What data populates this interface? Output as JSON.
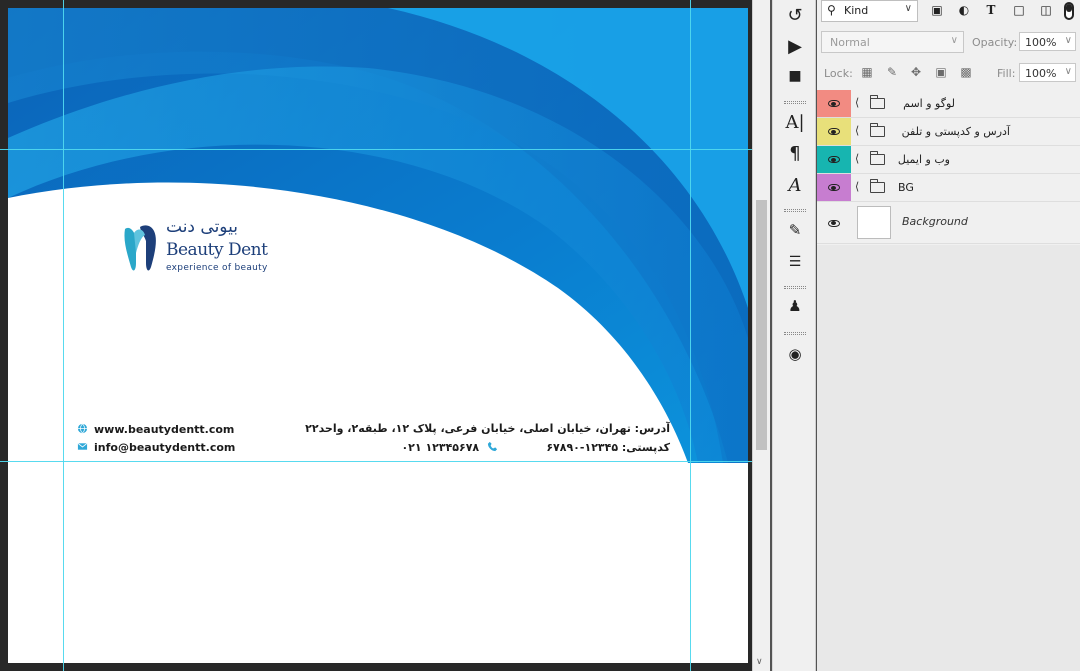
{
  "document": {
    "logo": {
      "persian_name": "بیوتی دنت",
      "english_name": "Beauty Dent",
      "tagline": "experience of beauty"
    },
    "contact": {
      "website": "www.beautydentt.com",
      "email": "info@beautydentt.com",
      "address": "آدرس: تهران، خیابان اصلی، خیابان فرعی، پلاک ۱۲، طبقه۲، واحد۲۲",
      "postal_code": "کدپستی: ۱۲۳۴۵-۶۷۸۹۰",
      "phone": "۰۲۱ ۱۲۳۴۵۶۷۸"
    },
    "colors": {
      "blue_dark": "#0a5cb0",
      "blue_mid": "#0d8ad6",
      "blue_light": "#24b2ee",
      "accent": "#2fb7e6"
    }
  },
  "tools": [
    {
      "icon": "history-brush-icon"
    },
    {
      "icon": "play-action-icon"
    },
    {
      "icon": "plugin-icon"
    },
    {
      "icon": "character-icon"
    },
    {
      "icon": "paragraph-icon"
    },
    {
      "icon": "glyphs-icon"
    },
    {
      "icon": "brush-presets-icon"
    },
    {
      "icon": "adjustments-icon"
    },
    {
      "icon": "clone-source-icon"
    },
    {
      "icon": "color-icon"
    }
  ],
  "layers_panel": {
    "filter_kind": "Kind",
    "blend_mode": "Normal",
    "opacity_label": "Opacity:",
    "opacity_value": "100%",
    "lock_label": "Lock:",
    "fill_label": "Fill:",
    "fill_value": "100%",
    "layers": [
      {
        "name": "لوگو و اسم",
        "color": "#f28b82"
      },
      {
        "name": "آدرس و کدپستی و تلفن",
        "color": "#e8e07a"
      },
      {
        "name": "وب و ایمیل",
        "color": "#17b5b0"
      },
      {
        "name": "BG",
        "color": "#c77dd0"
      }
    ],
    "background_layer": "Background"
  }
}
